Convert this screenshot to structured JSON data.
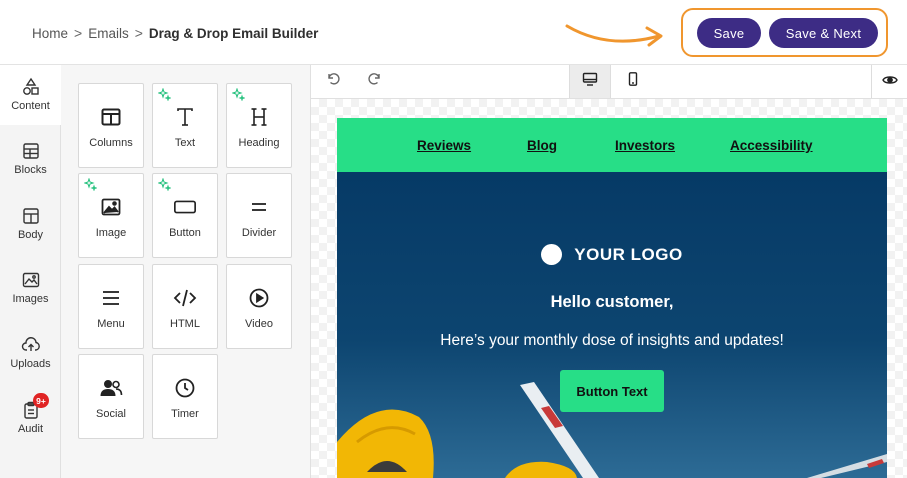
{
  "breadcrumb": {
    "home": "Home",
    "emails": "Emails",
    "current": "Drag & Drop Email Builder",
    "separator": ">"
  },
  "header": {
    "save_label": "Save",
    "save_next_label": "Save & Next",
    "accent_color": "#3d2c85",
    "highlight_color": "#f0962e"
  },
  "leftnav": {
    "items": [
      {
        "label": "Content",
        "icon": "shapes-icon"
      },
      {
        "label": "Blocks",
        "icon": "blocks-icon"
      },
      {
        "label": "Body",
        "icon": "layout-icon"
      },
      {
        "label": "Images",
        "icon": "image-icon"
      },
      {
        "label": "Uploads",
        "icon": "cloud-upload-icon"
      },
      {
        "label": "Audit",
        "icon": "clipboard-icon",
        "badge": "9+"
      }
    ]
  },
  "content_tiles": [
    {
      "label": "Columns",
      "icon": "columns-icon",
      "ai": false
    },
    {
      "label": "Text",
      "icon": "text-icon",
      "ai": true
    },
    {
      "label": "Heading",
      "icon": "heading-icon",
      "ai": true
    },
    {
      "label": "Image",
      "icon": "image-icon",
      "ai": true
    },
    {
      "label": "Button",
      "icon": "button-icon",
      "ai": true
    },
    {
      "label": "Divider",
      "icon": "divider-icon",
      "ai": false
    },
    {
      "label": "Menu",
      "icon": "menu-icon",
      "ai": false
    },
    {
      "label": "HTML",
      "icon": "code-icon",
      "ai": false
    },
    {
      "label": "Video",
      "icon": "play-icon",
      "ai": false
    },
    {
      "label": "Social",
      "icon": "users-icon",
      "ai": false
    },
    {
      "label": "Timer",
      "icon": "clock-icon",
      "ai": false
    }
  ],
  "email": {
    "nav_links": [
      "Reviews",
      "Blog",
      "Investors",
      "Accessibility"
    ],
    "logo_text": "YOUR LOGO",
    "title": "Hello customer,",
    "subtitle": "Here’s your monthly dose of insights and updates!",
    "button_text": "Button Text",
    "brand_green": "#27de87",
    "hero_blue": "#063a66"
  }
}
